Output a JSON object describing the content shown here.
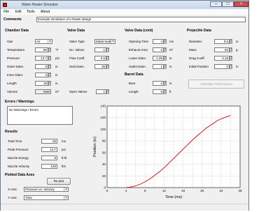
{
  "window": {
    "title": "Water Heater Simulator"
  },
  "menu": {
    "items": [
      "File",
      "Edit",
      "Tools",
      "About"
    ]
  },
  "comment": {
    "label": "Comments",
    "value": "Example simulation of a heater design"
  },
  "chamber": {
    "header": "Chamber Data",
    "rows": [
      {
        "label": "Gas",
        "value": "Air",
        "unit": ""
      },
      {
        "label": "Temperature",
        "value": "80",
        "unit": "°F"
      },
      {
        "label": "Pressure",
        "value": "14.7",
        "unit": "psi"
      },
      {
        "label": "Outer Diam.",
        "value": "6",
        "unit": "in"
      },
      {
        "label": "Inner Diam.",
        "value": "2",
        "unit": "in"
      },
      {
        "label": "Length",
        "value": "18",
        "unit": "in"
      },
      {
        "label": "Volume",
        "value": "NaN",
        "unit": "in³"
      }
    ]
  },
  "valve": {
    "header": "Valve Data",
    "rows": [
      {
        "label": "Valve Type",
        "value": "Metal Seal"
      },
      {
        "label": "No. Valves",
        "value": "1"
      },
      {
        "label": "Flow Coeff.",
        "value": "0.5"
      },
      {
        "label": "Seal Diam.",
        "value": "35"
      }
    ],
    "open_label": "Open Valves",
    "open_value": "1"
  },
  "valve_cont": {
    "header": "Valve Data (cont)",
    "rows": [
      {
        "label": "Opening Time",
        "value": "4",
        "unit": "ms"
      },
      {
        "label": "Exhaust Area",
        "value": "2",
        "unit": "in²"
      },
      {
        "label": "Lower Diam.",
        "value": "1.05",
        "unit": "in"
      },
      {
        "label": "Outlet Diam.",
        "value": "1",
        "unit": "in"
      }
    ]
  },
  "barrel": {
    "header": "Barrel Data",
    "rows": [
      {
        "label": "Bore",
        "value": "2",
        "unit": "in"
      },
      {
        "label": "Length",
        "value": "5",
        "unit": "ft"
      }
    ]
  },
  "projectile": {
    "header": "Projectile Data",
    "rows": [
      {
        "label": "Diameter",
        "value": "0.5",
        "unit": "in"
      },
      {
        "label": "Mass",
        "value": "50",
        "unit": "g"
      },
      {
        "label": "Drag Coeff.",
        "value": "0.15",
        "unit": ""
      },
      {
        "label": "Initial Position",
        "value": "0",
        "unit": "in"
      }
    ],
    "calc_button": "Calculate Performance"
  },
  "errors": {
    "header": "Errors / Warnings",
    "text": "No Warnings / Errors"
  },
  "results": {
    "header": "Results",
    "rows": [
      {
        "label": "Total Time",
        "value": "28",
        "unit": "ms"
      },
      {
        "label": "Peak Pressure",
        "value": "14.7",
        "unit": "psi"
      },
      {
        "label": "Muzzle Energy",
        "value": "8",
        "unit": "ft-lb"
      },
      {
        "label": "Muzzle Velocity",
        "value": "125",
        "unit": "ft/s"
      }
    ]
  },
  "plot_axes": {
    "header": "Plotted Data Axes",
    "x_label": "X Axis:",
    "x_value": "Pressure vs. Velocity",
    "y_label": "Y Axis:",
    "y_value": "Time",
    "replot_button": "Re-plot"
  },
  "chart_data": {
    "type": "line",
    "xlabel": "Time (ms)",
    "ylabel": "Position (in)",
    "xlim": [
      0,
      28
    ],
    "ylim": [
      0,
      140
    ],
    "xticks": [
      0,
      2,
      4,
      6,
      8,
      10,
      12,
      14,
      16,
      18,
      20,
      22,
      24,
      26,
      28
    ],
    "yticks": [
      0,
      20,
      40,
      60,
      80,
      100,
      120,
      140
    ],
    "grid": true,
    "series": [
      {
        "color": "#e00000",
        "x": [
          4,
          5,
          6,
          7,
          8,
          9,
          10,
          11,
          12,
          13,
          14,
          15,
          16,
          17,
          18,
          19,
          20,
          21,
          22,
          23,
          24,
          25,
          26
        ],
        "y": [
          0,
          1,
          3,
          6,
          10,
          15,
          21,
          27,
          34,
          42,
          50,
          58,
          66,
          74,
          82,
          89,
          96,
          103,
          108,
          114,
          118,
          121,
          124
        ]
      }
    ]
  }
}
